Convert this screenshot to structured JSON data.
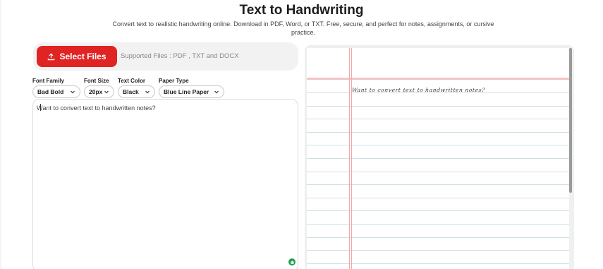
{
  "header": {
    "title": "Text to Handwriting",
    "subtitle": "Convert text to realistic handwriting online. Download in PDF, Word, or TXT. Free, secure, and perfect for notes, assignments, or cursive practice."
  },
  "upload": {
    "button_label": "Select Files",
    "supported_text": "Supported Files : PDF , TXT and DOCX",
    "button_color": "#e02424"
  },
  "controls": {
    "font_family": {
      "label": "Font Family",
      "value": "Bad Bold"
    },
    "font_size": {
      "label": "Font Size",
      "value": "20px"
    },
    "text_color": {
      "label": "Text Color",
      "value": "Black"
    },
    "paper_type": {
      "label": "Paper Type",
      "value": "Blue Line Paper"
    }
  },
  "editor": {
    "text": "Want to convert text to handwritten notes?"
  },
  "preview": {
    "handwritten_text": "Want to convert text to handwritten notes?",
    "paper_style": "blue-lines",
    "margin_color": "#f0a8a8",
    "line_color": "#cfe0e4"
  },
  "icons": [
    "upload-icon",
    "chevron-down-icon",
    "robot-icon"
  ]
}
